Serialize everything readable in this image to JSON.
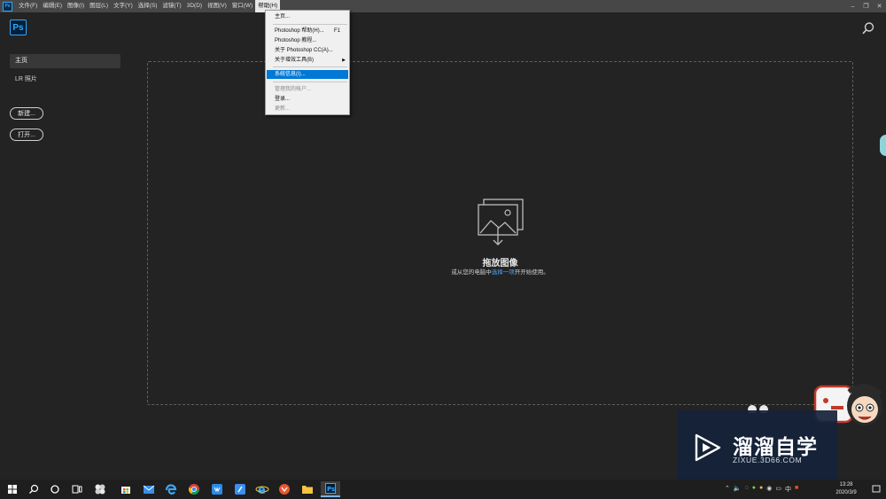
{
  "menubar": {
    "items": [
      "文件(F)",
      "编辑(E)",
      "图像(I)",
      "图层(L)",
      "文字(Y)",
      "选择(S)",
      "滤镜(T)",
      "3D(D)",
      "视图(V)",
      "窗口(W)",
      "帮助(H)"
    ],
    "active_index": 10
  },
  "header": {
    "logo_text": "Ps"
  },
  "sidebar": {
    "home_label": "主页",
    "lr_label": "LR 照片",
    "new_button": "新建...",
    "open_button": "打开..."
  },
  "dropzone": {
    "title": "拖放图像",
    "sub_before": "或从您的电脑中",
    "sub_link": "选择一项",
    "sub_after": "开开始使用。"
  },
  "help_menu": {
    "items": [
      {
        "label": "主页...",
        "shortcut": "",
        "state": "normal"
      },
      {
        "label": "Photoshop 帮助(H)...",
        "shortcut": "F1",
        "state": "normal"
      },
      {
        "label": "Photoshop 教程...",
        "shortcut": "",
        "state": "normal"
      },
      {
        "label": "关于 Photoshop CC(A)...",
        "shortcut": "",
        "state": "normal"
      },
      {
        "label": "关于增效工具(B)",
        "shortcut": "",
        "state": "submenu"
      },
      {
        "label": "系统信息(I)...",
        "shortcut": "",
        "state": "highlighted"
      },
      {
        "label": "管理我的帐户...",
        "shortcut": "",
        "state": "disabled"
      },
      {
        "label": "登录...",
        "shortcut": "",
        "state": "normal"
      },
      {
        "label": "更新...",
        "shortcut": "",
        "state": "disabled"
      }
    ]
  },
  "watermark": {
    "title": "溜溜自学",
    "url": "ZIXUE.3D66.COM"
  },
  "taskbar": {
    "tray_ime": "中",
    "time": "13:28",
    "date": "2020/3/9",
    "active_app": "photoshop-taskbar-icon"
  },
  "colors": {
    "accent": "#31a8ff",
    "menu_highlight": "#0078d7",
    "link": "#4aa4ff"
  }
}
